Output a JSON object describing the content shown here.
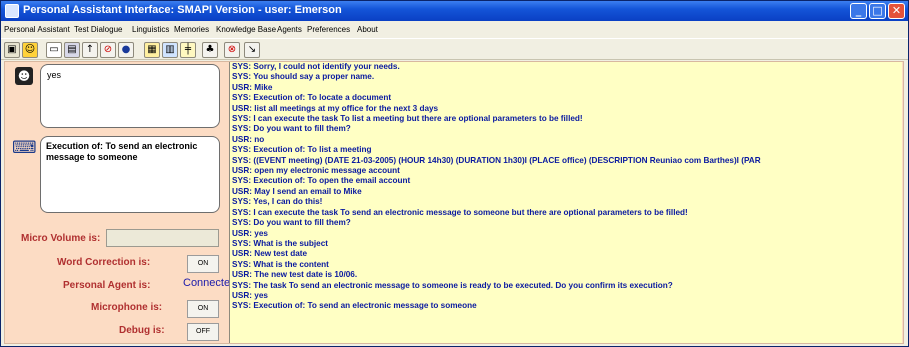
{
  "window": {
    "title": "Personal Assistant Interface: SMAPI Version - user: Emerson"
  },
  "menu": [
    "Personal Assistant",
    "Test Dialogue",
    "Linguistics",
    "Memories",
    "Knowledge Base",
    "Agents",
    "Preferences",
    "About"
  ],
  "toolbar_icons": [
    "open-icon",
    "smiley-icon",
    "save-icon",
    "print-icon",
    "pin-icon",
    "stop-icon",
    "record-icon",
    "table-icon",
    "grid-icon",
    "settings-icon",
    "microphone-icon",
    "close-red-icon",
    "help-icon"
  ],
  "user_input": "yes",
  "agent_output": "Execution of: To send an electronic message to someone",
  "labels": {
    "micro_volume": "Micro Volume is:",
    "word_correction": "Word Correction is:",
    "personal_agent": "Personal Agent is:",
    "microphone": "Microphone is:",
    "debug": "Debug is:"
  },
  "values": {
    "micro_volume": "",
    "word_correction": "ON",
    "personal_agent": "Connected",
    "microphone": "ON",
    "debug": "OFF"
  },
  "log": [
    "SYS: Sorry, I could not identify your needs.",
    "SYS: You should say a proper name.",
    "USR: Mike",
    "SYS: Execution of: To locate a document",
    "USR: list all meetings at my office for the next 3 days",
    "SYS: I can execute the task To list a meeting but there are optional parameters to be filled!",
    "SYS: Do you want to fill them?",
    "USR: no",
    "SYS: Execution of: To list a meeting",
    "SYS: ((EVENT meeting) (DATE 21-03-2005) (HOUR 14h30) (DURATION 1h30)I (PLACE office) (DESCRIPTION Reuniao com Barthes)I (PAR",
    "USR: open my electronic message account",
    "SYS: Execution of: To open the email account",
    "USR: May I send an email to Mike",
    "SYS: Yes, I can do this!",
    "SYS: I can execute the task To send an electronic message to someone but there are optional parameters to be filled!",
    "SYS: Do you want to fill them?",
    "USR: yes",
    "SYS: What is the subject",
    "USR: New test date",
    "SYS: What is the content",
    "USR: The new test date is 10/06.",
    "SYS: The task To send an electronic message to someone is ready to be executed. Do you confirm its execution?",
    "USR: yes",
    "SYS: Execution of: To send an electronic message to someone"
  ]
}
